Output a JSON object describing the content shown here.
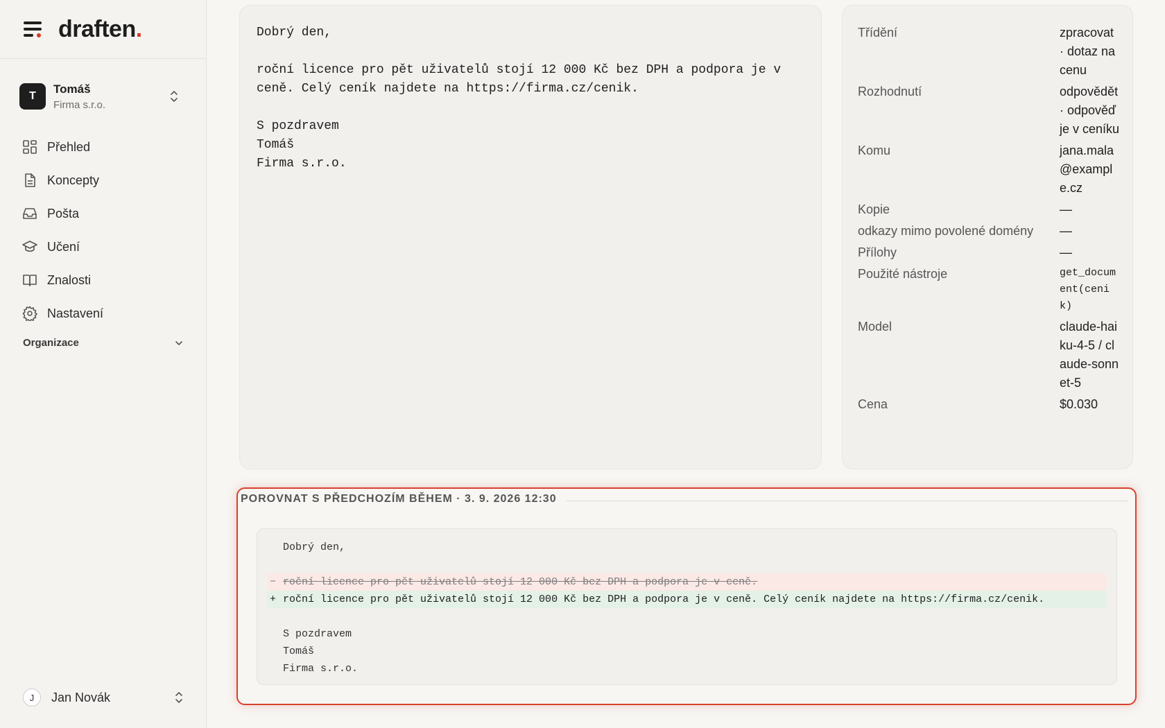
{
  "app": {
    "logo_main": "draften",
    "logo_dot": ".",
    "accent": "#d93a25"
  },
  "account": {
    "initial": "T",
    "name": "Tomáš",
    "org": "Firma s.r.o."
  },
  "nav": [
    {
      "label": "Přehled",
      "icon": "dashboard-icon"
    },
    {
      "label": "Koncepty",
      "icon": "document-icon"
    },
    {
      "label": "Pošta",
      "icon": "inbox-icon"
    },
    {
      "label": "Učení",
      "icon": "graduation-cap-icon"
    },
    {
      "label": "Znalosti",
      "icon": "book-icon"
    },
    {
      "label": "Nastavení",
      "icon": "gear-icon"
    }
  ],
  "org_section": "Organizace",
  "user": {
    "initial": "J",
    "name": "Jan Novák"
  },
  "email": {
    "lines": [
      "Dobrý den,",
      "",
      "roční licence pro pět uživatelů stojí 12 000 Kč bez DPH a podpora je v",
      "ceně. Celý ceník najdete na https://firma.cz/cenik.",
      "",
      "S pozdravem",
      "Tomáš",
      "Firma s.r.o."
    ]
  },
  "meta": [
    {
      "key": "Třídění",
      "value": "zpracovat · dotaz na cenu"
    },
    {
      "key": "Rozhodnutí",
      "value": "odpovědět · odpověď je v ceníku"
    },
    {
      "key": "Komu",
      "value": "jana.mala@example.cz"
    },
    {
      "key": "Kopie",
      "value": "—"
    },
    {
      "key": "odkazy mimo povolené domény",
      "value": "—"
    },
    {
      "key": "Přílohy",
      "value": "—"
    },
    {
      "key": "Použité nástroje",
      "value": "get_document(cenik)",
      "mono": true
    },
    {
      "key": "Model",
      "value": "claude-haiku-4-5 / claude-sonnet-5"
    },
    {
      "key": "Cena",
      "value": "$0.030"
    }
  ],
  "compare": {
    "title": "POROVNAT S PŘEDCHOZÍM BĚHEM · 3. 9. 2026 12:30",
    "lines": [
      {
        "type": "same",
        "sign": "",
        "text": "Dobrý den,"
      },
      {
        "type": "same",
        "sign": "",
        "text": ""
      },
      {
        "type": "removed",
        "sign": "−",
        "text": "roční licence pro pět uživatelů stojí 12 000 Kč bez DPH a podpora je v ceně."
      },
      {
        "type": "added",
        "sign": "+",
        "text": "roční licence pro pět uživatelů stojí 12 000 Kč bez DPH a podpora je v ceně. Celý ceník najdete na https://firma.cz/cenik."
      },
      {
        "type": "same",
        "sign": "",
        "text": ""
      },
      {
        "type": "same",
        "sign": "",
        "text": "S pozdravem"
      },
      {
        "type": "same",
        "sign": "",
        "text": "Tomáš"
      },
      {
        "type": "same",
        "sign": "",
        "text": "Firma s.r.o."
      }
    ]
  }
}
